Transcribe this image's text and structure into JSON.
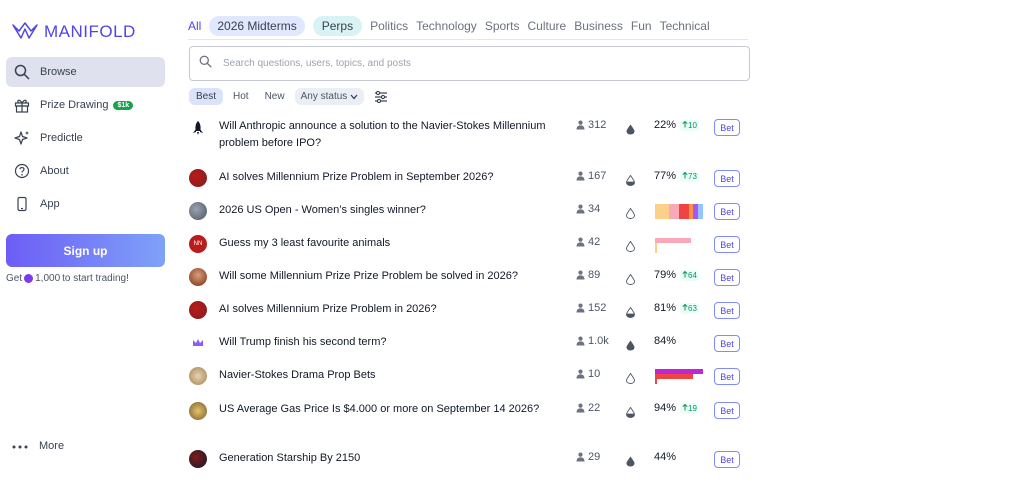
{
  "brand": {
    "name": "MANIFOLD"
  },
  "nav": [
    {
      "label": "Browse",
      "icon": "search-icon",
      "active": true
    },
    {
      "label": "Prize Drawing",
      "icon": "gift-icon",
      "badge": "$1k"
    },
    {
      "label": "Predictle",
      "icon": "sparkles-icon"
    },
    {
      "label": "About",
      "icon": "question-icon"
    },
    {
      "label": "App",
      "icon": "phone-icon"
    }
  ],
  "signup": {
    "label": "Sign up",
    "note_prefix": "Get",
    "note_amount": "1,000",
    "note_suffix": "to start trading!"
  },
  "more": {
    "label": "More"
  },
  "tabs": [
    "All",
    "2026 Midterms",
    "Perps",
    "Politics",
    "Technology",
    "Sports",
    "Culture",
    "Business",
    "Fun",
    "Technical"
  ],
  "search": {
    "placeholder": "Search questions, users, topics, and posts"
  },
  "filters": {
    "sort": [
      "Best",
      "Hot",
      "New"
    ],
    "status": "Any status"
  },
  "markets": [
    {
      "title": "Will Anthropic announce a solution to the Navier-Stokes Millennium problem before IPO?",
      "traders": "312",
      "prob": "22%",
      "change": "10",
      "liquidity": "dark",
      "bet": "Bet"
    },
    {
      "title": "AI solves Millennium Prize Problem in September 2026?",
      "traders": "167",
      "prob": "77%",
      "change": "73",
      "liquidity": "half",
      "bet": "Bet"
    },
    {
      "title": "2026 US Open - Women’s singles winner?",
      "traders": "34",
      "multi": [
        {
          "color": "#fcd089",
          "value": 0.3
        },
        {
          "color": "#f9a8b8",
          "value": 0.2
        },
        {
          "color": "#ef4444",
          "value": 0.2
        },
        {
          "color": "#fb923c",
          "value": 0.1
        },
        {
          "color": "#a855f7",
          "value": 0.1
        },
        {
          "color": "#93c5fd",
          "value": 0.1
        }
      ],
      "liquidity": "empty",
      "bet": "Bet"
    },
    {
      "title": "Guess my 3 least favourite animals",
      "traders": "42",
      "multi": [
        {
          "color": "#f9a8b8",
          "value": 1.0
        }
      ],
      "liquidity": "empty",
      "bet": "Bet"
    },
    {
      "title": "Will some Millennium Prize Prize Problem be solved in 2026?",
      "traders": "89",
      "prob": "79%",
      "change": "64",
      "liquidity": "empty",
      "bet": "Bet"
    },
    {
      "title": "AI solves Millennium Prize Problem in 2026?",
      "traders": "152",
      "prob": "81%",
      "change": "63",
      "liquidity": "half",
      "bet": "Bet"
    },
    {
      "title": "Will Trump finish his second term?",
      "traders": "1.0k",
      "prob": "84%",
      "liquidity": "dark",
      "bet": "Bet"
    },
    {
      "title": "Navier-Stokes Drama Prop Bets",
      "traders": "10",
      "multi": [
        {
          "color": "#c026d3",
          "value": 1.0
        },
        {
          "color": "#ef4444",
          "value": 0.8
        }
      ],
      "liquidity": "empty",
      "bet": "Bet"
    },
    {
      "title": "US Average Gas Price Is $4.000 or more on September 14 2026?",
      "traders": "22",
      "prob": "94%",
      "change": "19",
      "liquidity": "half",
      "bet": "Bet"
    },
    {
      "title": "Generation Starship By 2150",
      "traders": "29",
      "prob": "44%",
      "liquidity": "dark",
      "bet": "Bet"
    }
  ]
}
